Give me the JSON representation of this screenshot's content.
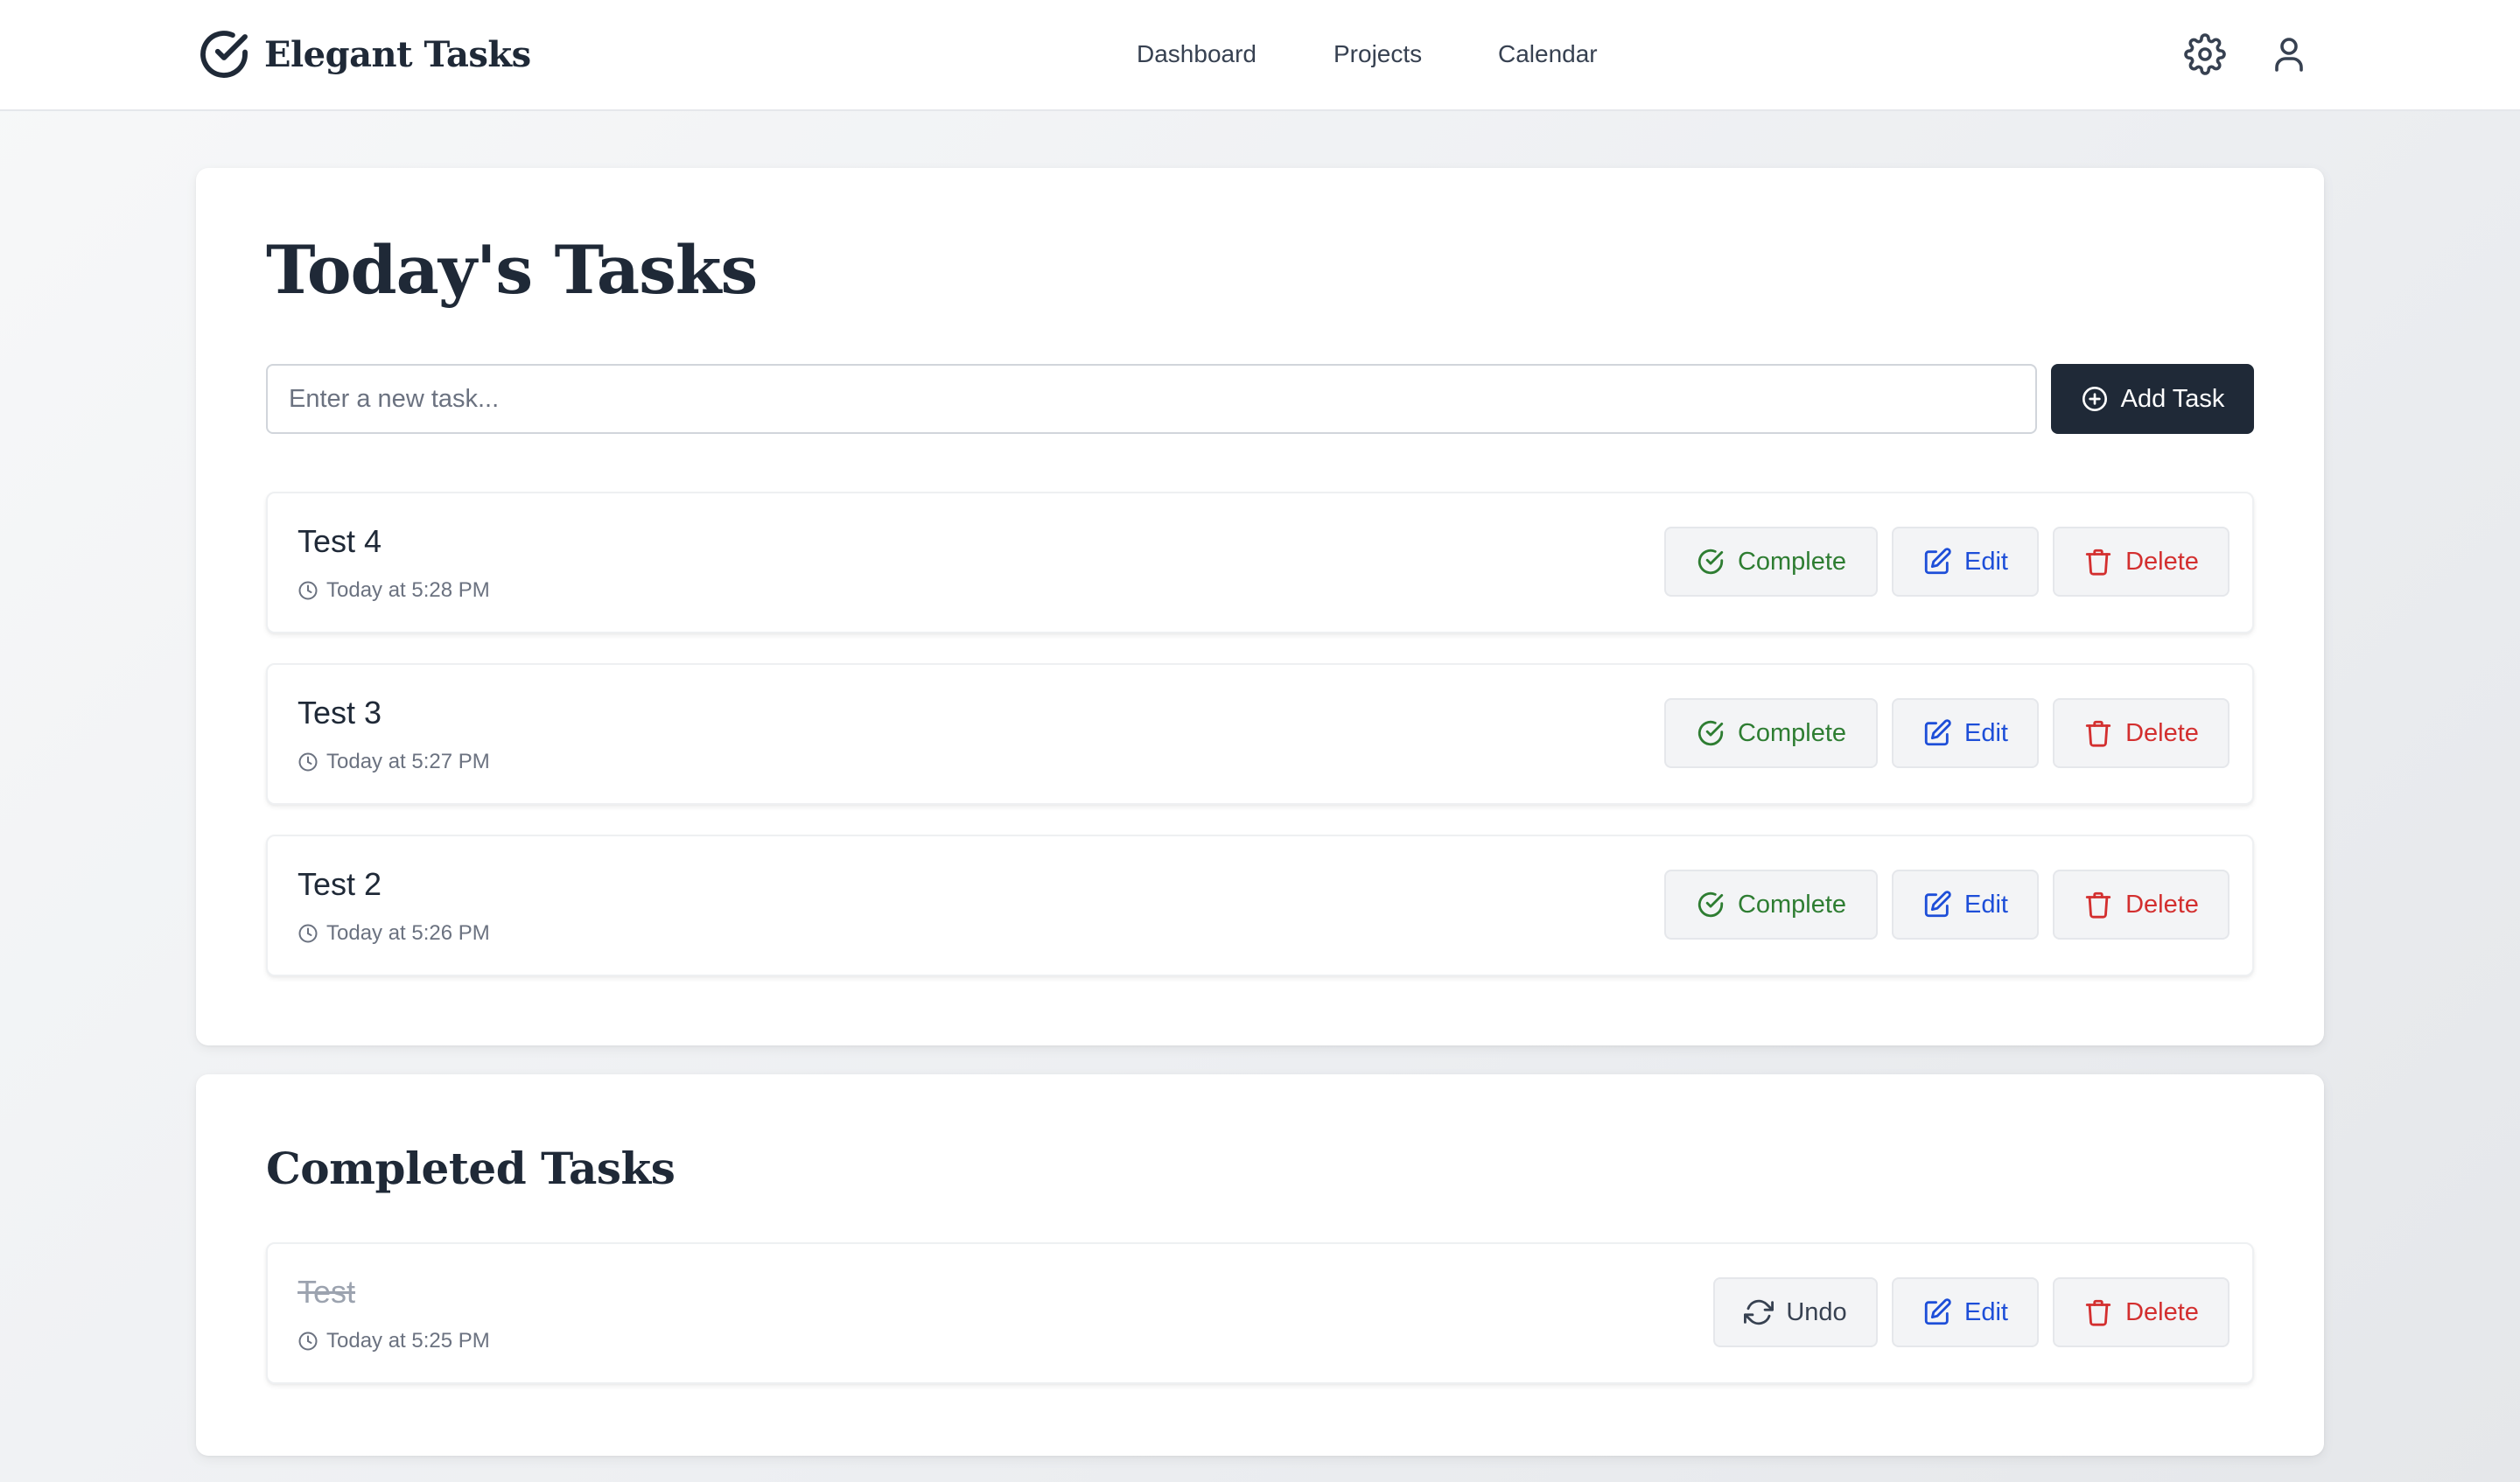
{
  "app": {
    "name": "Elegant Tasks",
    "logo_icon": "check-circle-icon"
  },
  "nav": {
    "items": [
      {
        "label": "Dashboard"
      },
      {
        "label": "Projects"
      },
      {
        "label": "Calendar"
      }
    ],
    "settings_icon": "gear-icon",
    "profile_icon": "user-icon"
  },
  "today": {
    "title": "Today's Tasks",
    "input": {
      "placeholder": "Enter a new task...",
      "value": ""
    },
    "add_button": {
      "label": "Add Task",
      "icon": "plus-circle-icon"
    },
    "tasks": [
      {
        "title": "Test 4",
        "time": "Today at 5:28 PM"
      },
      {
        "title": "Test 3",
        "time": "Today at 5:27 PM"
      },
      {
        "title": "Test 2",
        "time": "Today at 5:26 PM"
      }
    ]
  },
  "completed": {
    "title": "Completed Tasks",
    "tasks": [
      {
        "title": "Test",
        "time": "Today at 5:25 PM"
      }
    ]
  },
  "actions": {
    "complete": "Complete",
    "undo": "Undo",
    "edit": "Edit",
    "delete": "Delete"
  },
  "colors": {
    "primary": "#1f2937",
    "complete": "#2e7d32",
    "edit": "#1d4ed8",
    "delete": "#d32f2f",
    "muted": "#6b7280"
  }
}
